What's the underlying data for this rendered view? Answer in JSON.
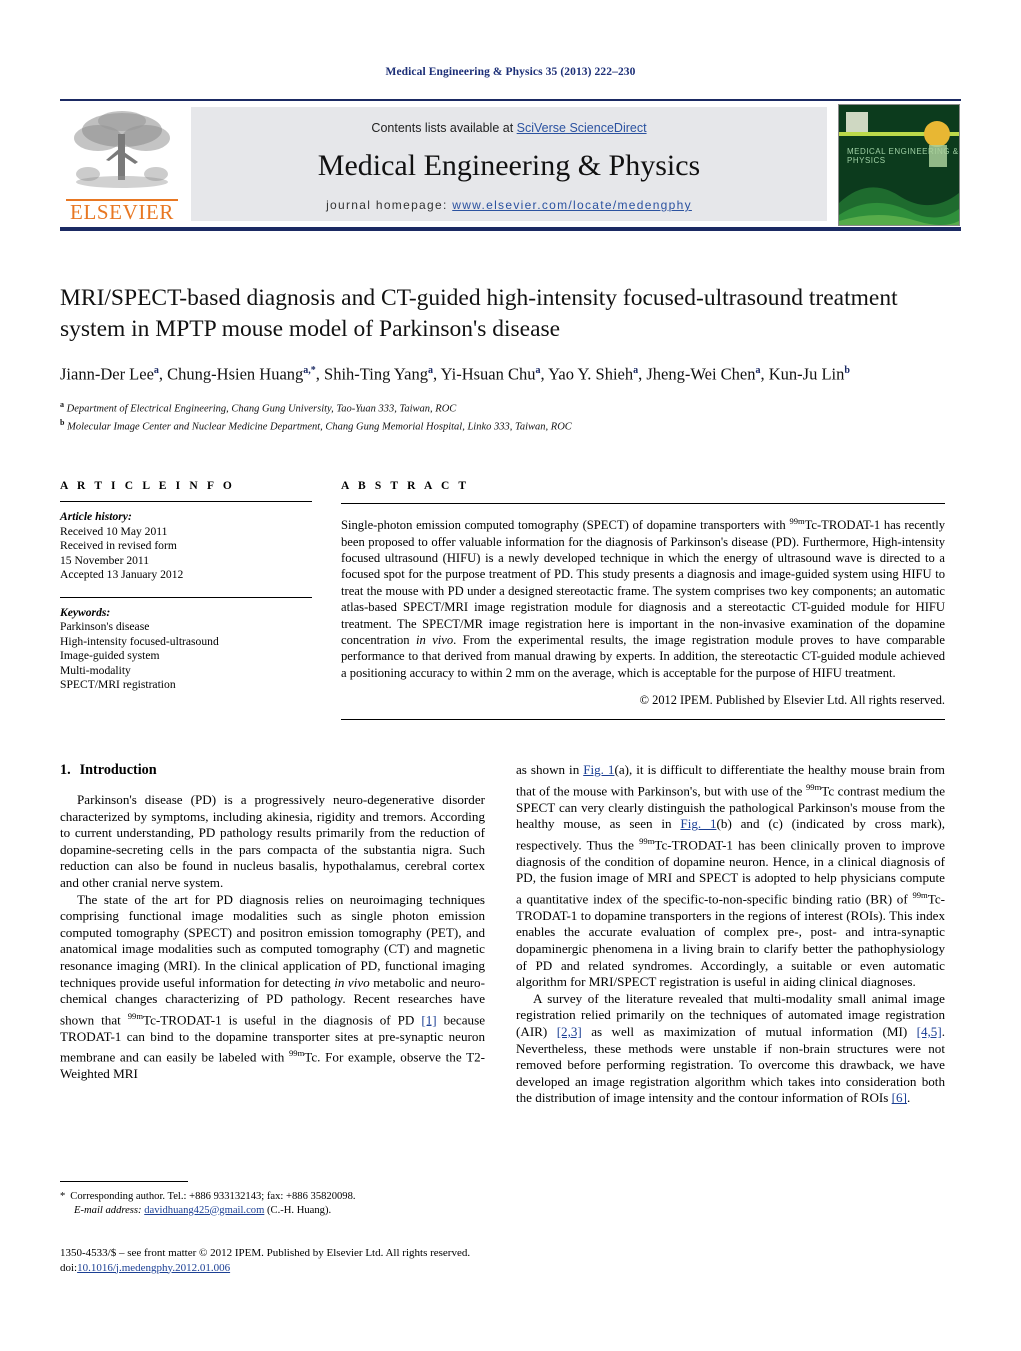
{
  "running_head": "Medical Engineering & Physics 35 (2013) 222–230",
  "masthead": {
    "contents_prefix": "Contents lists available at ",
    "contents_link": "SciVerse ScienceDirect",
    "journal_title": "Medical Engineering & Physics",
    "homepage_label": "journal homepage: ",
    "homepage_url": "www.elsevier.com/locate/medengphy",
    "publisher_wordmark": "ELSEVIER",
    "cover_title": "MEDICAL ENGINEERING & PHYSICS"
  },
  "article": {
    "title": "MRI/SPECT-based diagnosis and CT-guided high-intensity focused-ultrasound treatment system in MPTP mouse model of Parkinson's disease",
    "authors": [
      {
        "name": "Jiann-Der Lee",
        "marks": "a"
      },
      {
        "name": "Chung-Hsien Huang",
        "marks": "a,*"
      },
      {
        "name": "Shih-Ting Yang",
        "marks": "a"
      },
      {
        "name": "Yi-Hsuan Chu",
        "marks": "a"
      },
      {
        "name": "Yao Y. Shieh",
        "marks": "a"
      },
      {
        "name": "Jheng-Wei Chen",
        "marks": "a"
      },
      {
        "name": "Kun-Ju Lin",
        "marks": "b"
      }
    ],
    "affiliations": [
      {
        "mark": "a",
        "text": "Department of Electrical Engineering, Chang Gung University, Tao-Yuan 333, Taiwan, ROC"
      },
      {
        "mark": "b",
        "text": "Molecular Image Center and Nuclear Medicine Department, Chang Gung Memorial Hospital, Linko 333, Taiwan, ROC"
      }
    ]
  },
  "article_info": {
    "heading": "A R T I C L E   I N F O",
    "history_label": "Article history:",
    "history_lines": [
      "Received 10 May 2011",
      "Received in revised form",
      "15 November 2011",
      "Accepted 13 January 2012"
    ],
    "keywords_label": "Keywords:",
    "keywords": [
      "Parkinson's disease",
      "High-intensity focused-ultrasound",
      "Image-guided system",
      "Multi-modality",
      "SPECT/MRI registration"
    ]
  },
  "abstract": {
    "heading": "A B S T R A C T",
    "text_parts": [
      {
        "t": "Single-photon emission computed tomography (SPECT) of dopamine transporters with "
      },
      {
        "t": "99m",
        "sup": true
      },
      {
        "t": "Tc-TRODAT-1 has recently been proposed to offer valuable information for the diagnosis of Parkinson's disease (PD). Furthermore, High-intensity focused ultrasound (HIFU) is a newly developed technique in which the energy of ultrasound wave is directed to a focused spot for the purpose treatment of PD. This study presents a diagnosis and image-guided system using HIFU to treat the mouse with PD under a designed stereotactic frame. The system comprises two key components; an automatic atlas-based SPECT/MRI image registration module for diagnosis and a stereotactic CT-guided module for HIFU treatment. The SPECT/MR image registration here is important in the non-invasive examination of the dopamine concentration "
      },
      {
        "t": "in vivo",
        "italic": true
      },
      {
        "t": ". From the experimental results, the image registration module proves to have comparable performance to that derived from manual drawing by experts. In addition, the stereotactic CT-guided module achieved a positioning accuracy to within 2 mm on the average, which is acceptable for the purpose of HIFU treatment."
      }
    ],
    "copyright": "© 2012 IPEM. Published by Elsevier Ltd. All rights reserved."
  },
  "introduction": {
    "number": "1.",
    "heading": "Introduction",
    "left_paragraphs": [
      [
        {
          "t": "Parkinson's disease (PD) is a progressively neuro-degenerative disorder characterized by symptoms, including akinesia, rigidity and tremors. According to current understanding, PD pathology results primarily from the reduction of dopamine-secreting cells in the pars compacta of the substantia nigra. Such reduction can also be found in nucleus basalis, hypothalamus, cerebral cortex and other cranial nerve system."
        }
      ],
      [
        {
          "t": "The state of the art for PD diagnosis relies on neuroimaging techniques comprising functional image modalities such as single photon emission computed tomography (SPECT) and positron emission tomography (PET), and anatomical image modalities such as computed tomography (CT) and magnetic resonance imaging (MRI). In the clinical application of PD, functional imaging techniques provide useful information for detecting "
        },
        {
          "t": "in vivo",
          "italic": true
        },
        {
          "t": " metabolic and neuro-chemical changes characterizing of PD pathology. Recent researches have shown that "
        },
        {
          "t": "99m",
          "sup": true
        },
        {
          "t": "Tc-TRODAT-1 is useful in the diagnosis of PD "
        },
        {
          "t": "[1]",
          "ref": true
        },
        {
          "t": " because TRODAT-1 can bind to the dopamine transporter sites at pre-synaptic neuron membrane and can easily be labeled with "
        },
        {
          "t": "99m",
          "sup": true
        },
        {
          "t": "Tc. For example, observe the T2-Weighted MRI"
        }
      ]
    ],
    "right_paragraphs": [
      [
        {
          "t": "as shown in "
        },
        {
          "t": "Fig. 1",
          "ref": true
        },
        {
          "t": "(a), it is difficult to differentiate the healthy mouse brain from that of the mouse with Parkinson's, but with use of the "
        },
        {
          "t": "99m",
          "sup": true
        },
        {
          "t": "Tc contrast medium the SPECT can very clearly distinguish the pathological Parkinson's mouse from the healthy mouse, as seen in "
        },
        {
          "t": "Fig. 1",
          "ref": true
        },
        {
          "t": "(b) and (c) (indicated by cross mark), respectively. Thus the "
        },
        {
          "t": "99m",
          "sup": true
        },
        {
          "t": "Tc-TRODAT-1 has been clinically proven to improve diagnosis of the condition of dopamine neuron. Hence, in a clinical diagnosis of PD, the fusion image of MRI and SPECT is adopted to help physicians compute a quantitative index of the specific-to-non-specific binding ratio (BR) of "
        },
        {
          "t": "99m",
          "sup": true
        },
        {
          "t": "Tc-TRODAT-1 to dopamine transporters in the regions of interest (ROIs). This index enables the accurate evaluation of complex pre-, post- and intra-synaptic dopaminergic phenomena in a living brain to clarify better the pathophysiology of PD and related syndromes. Accordingly, a suitable or even automatic algorithm for MRI/SPECT registration is useful in aiding clinical diagnoses."
        }
      ],
      [
        {
          "t": "A survey of the literature revealed that multi-modality small animal image registration relied primarily on the techniques of automated image registration (AIR) "
        },
        {
          "t": "[2,3]",
          "ref": true
        },
        {
          "t": " as well as maximization of mutual information (MI) "
        },
        {
          "t": "[4,5]",
          "ref": true
        },
        {
          "t": ". Nevertheless, these methods were unstable if non-brain structures were not removed before performing registration. To overcome this drawback, we have developed an image registration algorithm which takes into consideration both the distribution of image intensity and the contour information of ROIs "
        },
        {
          "t": "[6]",
          "ref": true
        },
        {
          "t": "."
        }
      ]
    ]
  },
  "footnote": {
    "corresponding": "Corresponding author. Tel.: +886 933132143; fax: +886 35820098.",
    "email_label": "E-mail address:",
    "email": "davidhuang425@gmail.com",
    "email_suffix": "(C.-H. Huang)."
  },
  "issn_line": "1350-4533/$ – see front matter © 2012 IPEM. Published by Elsevier Ltd. All rights reserved.",
  "doi_label": "doi:",
  "doi_value": "10.1016/j.medengphy.2012.01.006",
  "colors": {
    "header_blue": "#1c2f77",
    "link_blue": "#2b52a0",
    "ref_blue": "#1b3f94",
    "elsevier_orange": "#e87722",
    "band_grey": "#e6e7ea"
  }
}
